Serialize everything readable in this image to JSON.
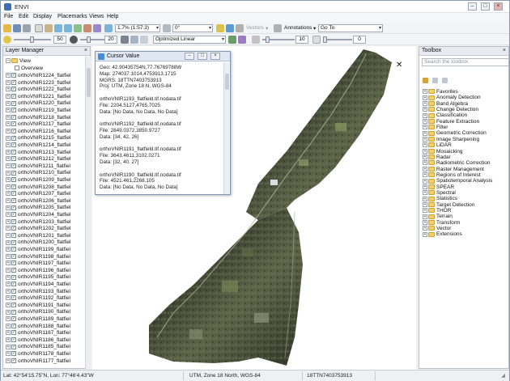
{
  "window": {
    "title": "ENVI"
  },
  "menu": [
    "File",
    "Edit",
    "Display",
    "Placemarks",
    "Views",
    "Help"
  ],
  "toolbar1": {
    "zoom_value": "1.7% (1:57.3)",
    "rotation_value": "0°",
    "vectors_label": "Vectors",
    "annotations_label": "Annotations",
    "goto_label": "Go To"
  },
  "toolbar2": {
    "brightness_value": "50",
    "contrast_value": "20",
    "stretch_value": "Optimized Linear",
    "sharpen_value": "10",
    "transparency_value": "0"
  },
  "layer_manager": {
    "title": "Layer Manager",
    "root": "View",
    "overview": "Overview",
    "layers": [
      "orthoVNIR1224_flatfiel",
      "orthoVNIR1223_flatfiel",
      "orthoVNIR1222_flatfiel",
      "orthoVNIR1221_flatfiel",
      "orthoVNIR1220_flatfiel",
      "orthoVNIR1219_flatfiel",
      "orthoVNIR1218_flatfiel",
      "orthoVNIR1217_flatfiel",
      "orthoVNIR1216_flatfiel",
      "orthoVNIR1215_flatfiel",
      "orthoVNIR1214_flatfiel",
      "orthoVNIR1213_flatfiel",
      "orthoVNIR1212_flatfiel",
      "orthoVNIR1211_flatfiel",
      "orthoVNIR1210_flatfiel",
      "orthoVNIR1209_flatfiel",
      "orthoVNIR1208_flatfiel",
      "orthoVNIR1207_flatfiel",
      "orthoVNIR1206_flatfiel",
      "orthoVNIR1205_flatfiel",
      "orthoVNIR1204_flatfiel",
      "orthoVNIR1203_flatfiel",
      "orthoVNIR1202_flatfiel",
      "orthoVNIR1201_flatfiel",
      "orthoVNIR1200_flatfiel",
      "orthoVNIR1199_flatfiel",
      "orthoVNIR1198_flatfiel",
      "orthoVNIR1197_flatfiel",
      "orthoVNIR1196_flatfiel",
      "orthoVNIR1195_flatfiel",
      "orthoVNIR1194_flatfiel",
      "orthoVNIR1193_flatfiel",
      "orthoVNIR1192_flatfiel",
      "orthoVNIR1191_flatfiel",
      "orthoVNIR1190_flatfiel",
      "orthoVNIR1189_flatfiel",
      "orthoVNIR1188_flatfiel",
      "orthoVNIR1187_flatfiel",
      "orthoVNIR1186_flatfiel",
      "orthoVNIR1185_flatfiel",
      "orthoVNIR1178_flatfiel",
      "orthoVNIR1177_flatfiel"
    ]
  },
  "cursor_value": {
    "title": "Cursor Value",
    "lines": [
      "Geo: 42.90435754N,77.76769788W",
      "Map: 274037.1014,4753913.1715",
      "MGRS: 18TTN7403753913",
      "Proj: UTM, Zone 18 N, WGS-84",
      "",
      "orthoVNIR1193_flatfield.tif.nodata.tif",
      "  File: 2204.5127,4765.7025",
      "  Data: [No Data, No Data, No Data]",
      "",
      "orthoVNIR1192_flatfield.tif.nodata.tif",
      "  File: 2849.0372,3850.9727",
      "  Data: [34, 42, 26]",
      "",
      "orthoVNIR1191_flatfield.tif.nodata.tif",
      "  File: 3643.4611,3102.0271",
      "  Data: [32, 40, 27]",
      "",
      "orthoVNIR1190_flatfield.tif.nodata.tif",
      "  File: 4521.461,2268.105",
      "  Data: [No Data, No Data, No Data]"
    ]
  },
  "toolbox": {
    "title": "Toolbox",
    "search_placeholder": "Search the toolbox",
    "items": [
      "Favorites",
      "Anomaly Detection",
      "Band Algebra",
      "Change Detection",
      "Classification",
      "Feature Extraction",
      "Filter",
      "Geometric Correction",
      "Image Sharpening",
      "LiDAR",
      "Mosaicking",
      "Radar",
      "Radiometric Correction",
      "Raster Management",
      "Regions of Interest",
      "Spatiotemporal Analysis",
      "SPEAR",
      "Spectral",
      "Statistics",
      "Target Detection",
      "THOR",
      "Terrain",
      "Transform",
      "Vector",
      "Extensions"
    ]
  },
  "status": {
    "latlon": "Lat: 42°54'15.75\"N, Lon: 77°46'4.43\"W",
    "projection": "UTM, Zone 18 North, WGS-84",
    "mgrs": "18TTN7403753913"
  },
  "colors": {
    "imagery_dark": "#2b3326",
    "imagery_mid": "#55603f",
    "imagery_light": "#8b8d77"
  }
}
